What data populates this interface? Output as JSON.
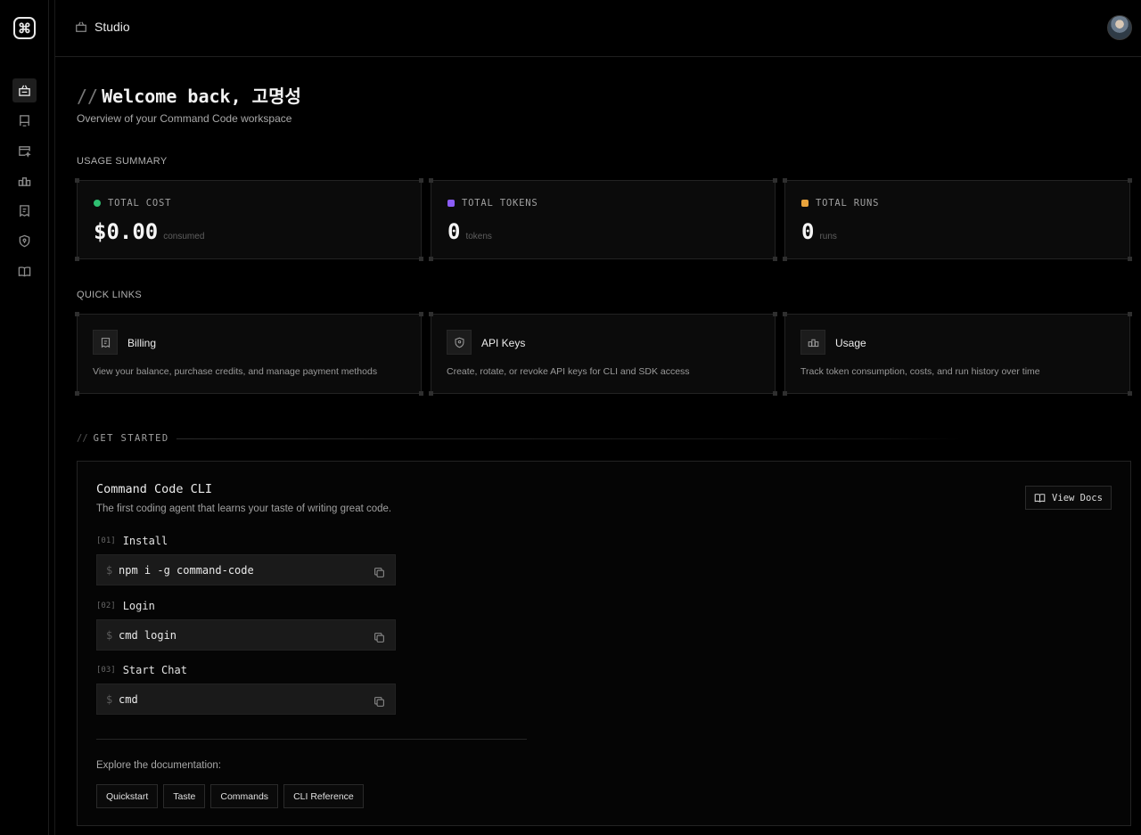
{
  "app": {
    "logo_glyph": "⌘",
    "title": "Studio"
  },
  "sidebar": {
    "items": [
      {
        "name": "studio",
        "icon": "studio-icon",
        "active": true
      },
      {
        "name": "models",
        "icon": "stack-icon",
        "active": false
      },
      {
        "name": "taste",
        "icon": "sparkle-window-icon",
        "active": false
      },
      {
        "name": "usage",
        "icon": "bars-icon",
        "active": false
      },
      {
        "name": "billing",
        "icon": "receipt-icon",
        "active": false
      },
      {
        "name": "api-keys",
        "icon": "shield-icon",
        "active": false
      },
      {
        "name": "docs",
        "icon": "book-icon",
        "active": false
      }
    ]
  },
  "welcome": {
    "prefix": "//",
    "heading": "Welcome back, 고명성",
    "subtitle": "Overview of your Command Code workspace"
  },
  "usage_summary": {
    "label": "USAGE SUMMARY",
    "stats": [
      {
        "label": "TOTAL COST",
        "value": "$0.00",
        "unit": "consumed",
        "color": "#2fbf71"
      },
      {
        "label": "TOTAL TOKENS",
        "value": "0",
        "unit": "tokens",
        "color": "#8b5cf6"
      },
      {
        "label": "TOTAL RUNS",
        "value": "0",
        "unit": "runs",
        "color": "#e8a33c"
      }
    ]
  },
  "quick_links": {
    "label": "QUICK LINKS",
    "items": [
      {
        "title": "Billing",
        "desc": "View your balance, purchase credits, and manage payment methods",
        "icon": "receipt-icon"
      },
      {
        "title": "API Keys",
        "desc": "Create, rotate, or revoke API keys for CLI and SDK access",
        "icon": "shield-icon"
      },
      {
        "title": "Usage",
        "desc": "Track token consumption, costs, and run history over time",
        "icon": "bars-icon"
      }
    ]
  },
  "get_started": {
    "prefix": "//",
    "label": "GET STARTED",
    "cli_title": "Command Code CLI",
    "cli_desc": "The first coding agent that learns your taste of writing great code.",
    "view_docs": "View Docs",
    "steps": [
      {
        "num": "[01]",
        "name": "Install",
        "prompt": "$",
        "command": "npm i -g command-code"
      },
      {
        "num": "[02]",
        "name": "Login",
        "prompt": "$",
        "command": "cmd login"
      },
      {
        "num": "[03]",
        "name": "Start Chat",
        "prompt": "$",
        "command": "cmd"
      }
    ],
    "explore": "Explore the documentation:",
    "chips": [
      "Quickstart",
      "Taste",
      "Commands",
      "CLI Reference"
    ]
  }
}
